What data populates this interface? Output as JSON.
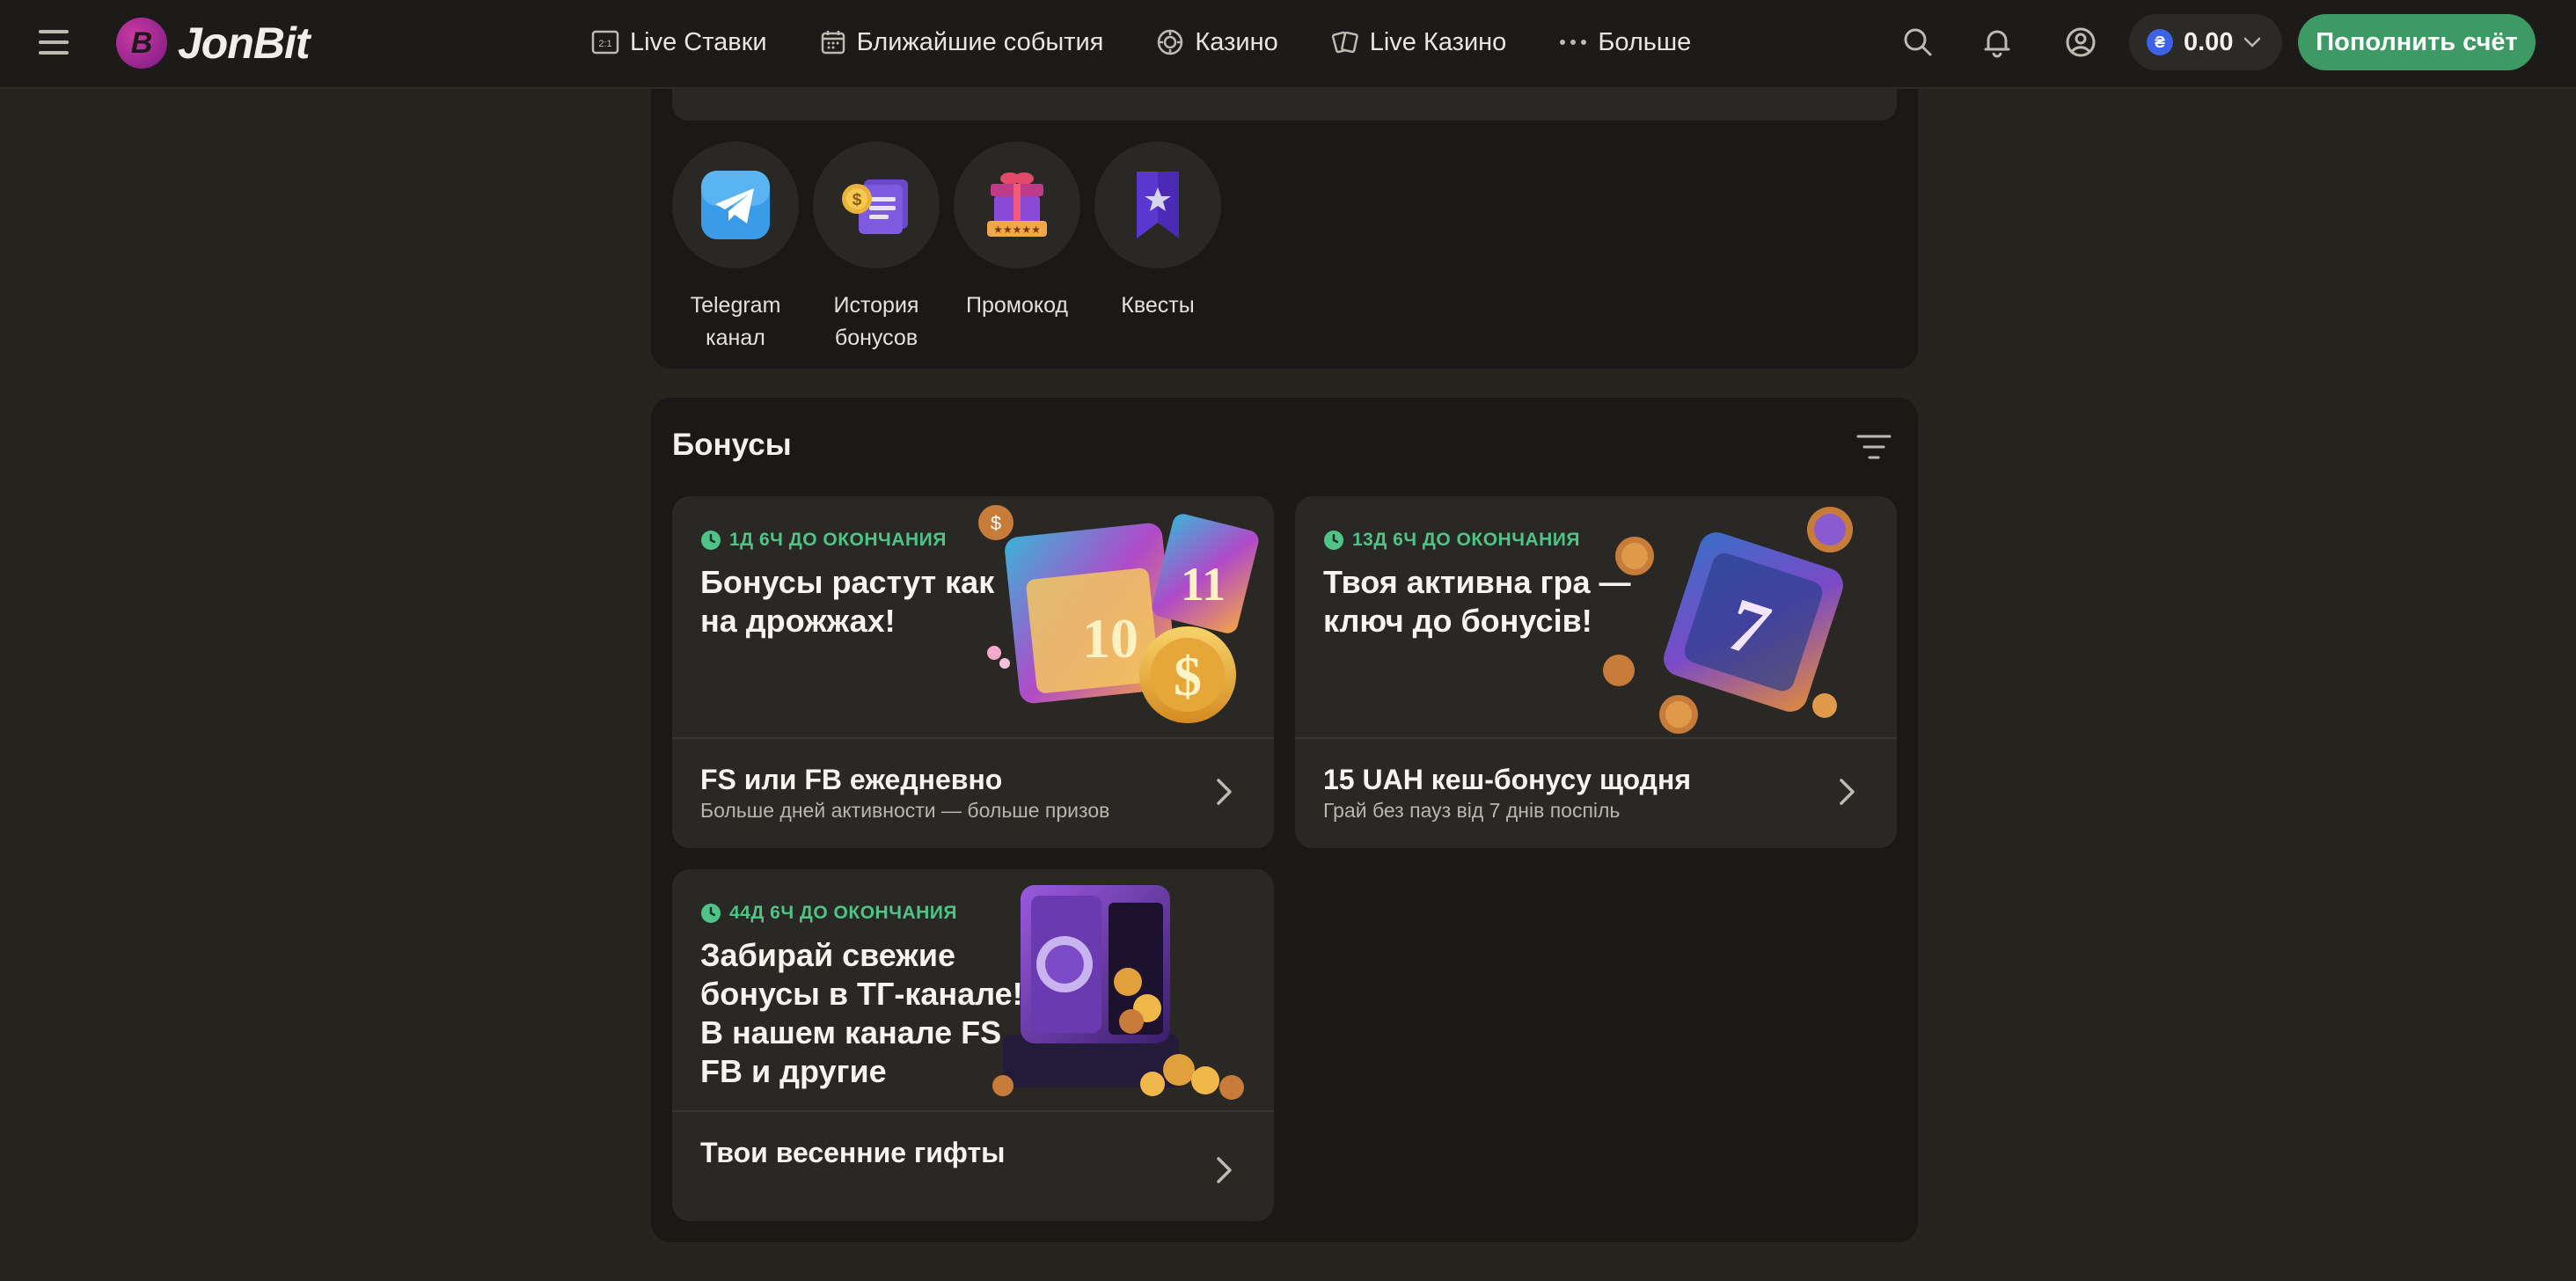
{
  "header": {
    "logo_text": "JonBit",
    "nav": [
      {
        "label": "Live Ставки",
        "icon": "live-bets-icon"
      },
      {
        "label": "Ближайшие события",
        "icon": "calendar-icon"
      },
      {
        "label": "Казино",
        "icon": "casino-chip-icon"
      },
      {
        "label": "Live Казино",
        "icon": "playing-cards-icon"
      },
      {
        "label": "Больше",
        "icon": "more-dots-icon"
      }
    ],
    "balance": "0.00",
    "currency_symbol": "₴",
    "deposit_label": "Пополнить счёт"
  },
  "quick_links": [
    {
      "label_line1": "Telegram",
      "label_line2": "канал",
      "icon": "telegram-icon"
    },
    {
      "label_line1": "История",
      "label_line2": "бонусов",
      "icon": "bonus-history-icon"
    },
    {
      "label_line1": "Промокод",
      "label_line2": "",
      "icon": "promo-gift-icon"
    },
    {
      "label_line1": "Квесты",
      "label_line2": "",
      "icon": "quests-bookmark-icon"
    }
  ],
  "bonuses": {
    "title": "Бонусы",
    "cards": [
      {
        "badge": "1Д 6Ч ДО ОКОНЧАНИЯ",
        "headline": "Бонусы растут как на дрожжах!",
        "sub_title": "FS или FB ежедневно",
        "sub_desc": "Больше дней активности — больше призов",
        "image": "calendar-coins-illustration"
      },
      {
        "badge": "13Д 6Ч ДО ОКОНЧАНИЯ",
        "headline": "Твоя активна гра — ключ до бонусів!",
        "sub_title": "15 UAH кеш-бонусу щодня",
        "sub_desc": "Грай без пауз від 7 днів поспіль",
        "image": "lucky-seven-calendar-illustration"
      },
      {
        "badge": "44Д 6Ч ДО ОКОНЧАНИЯ",
        "headline": "Забирай свежие бонусы в ТГ-канале! В нашем канале FS, FB и другие призы…",
        "sub_title": "Твои весенние гифты",
        "sub_desc": "",
        "image": "safe-coins-illustration"
      }
    ]
  },
  "colors": {
    "background": "#26241f",
    "panel": "#1a1917",
    "card": "#2a2825",
    "accent_green": "#3d9a64",
    "badge_green": "#4ec486"
  }
}
